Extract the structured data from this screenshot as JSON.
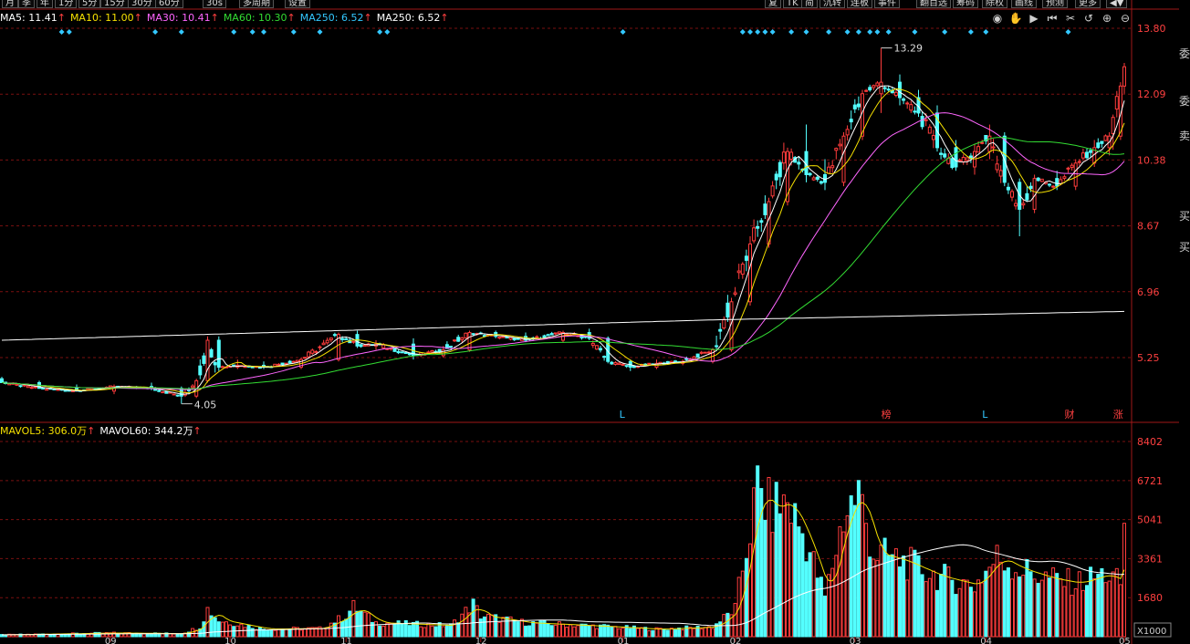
{
  "toolbar": {
    "left_buttons": [
      "月",
      "季",
      "年",
      "1分",
      "5分",
      "15分",
      "30分",
      "60分",
      "30s",
      "多周期",
      "设置"
    ],
    "right_buttons": [
      "复",
      "TK",
      "简",
      "沉转",
      "连板",
      "事件",
      "翻百选",
      "筹码",
      "除权",
      "画线",
      "预测",
      "更多"
    ]
  },
  "ma_legend": [
    {
      "label": "MA5: 11.41",
      "arrow": "↑",
      "color": "#ffffff"
    },
    {
      "label": "MA10: 11.00",
      "arrow": "↑",
      "color": "#f5e000"
    },
    {
      "label": "MA30: 10.41",
      "arrow": "↑",
      "color": "#ff66ff"
    },
    {
      "label": "MA60: 10.30",
      "arrow": "↑",
      "color": "#33dd33"
    },
    {
      "label": "MA250: 6.52",
      "arrow": "↑",
      "color": "#33c8ff"
    },
    {
      "label": "MA250: 6.52",
      "arrow": "↑",
      "color": "#ffffff"
    }
  ],
  "vol_legend": [
    {
      "label": "MAVOL5: 306.0万",
      "arrow": "↑",
      "color": "#f5e000"
    },
    {
      "label": "MAVOL60: 344.2万",
      "arrow": "↑",
      "color": "#ffffff"
    }
  ],
  "chart_tools": [
    "eye-icon",
    "hand-icon",
    "play-icon",
    "rewind-icon",
    "scissors-icon",
    "replay-icon",
    "zoom-in-icon",
    "zoom-out-icon"
  ],
  "colors": {
    "up": "#ff3c3c",
    "down": "#54ffff",
    "grid": "#7a1010",
    "axis_text": "#ff4040",
    "bg": "#000000"
  },
  "chart_data": {
    "type": "candlestick",
    "price_axis_ticks": [
      "13.80",
      "12.09",
      "10.38",
      "8.67",
      "6.96",
      "5.25"
    ],
    "price_range": [
      3.54,
      13.8
    ],
    "volume_axis_ticks": [
      "8402",
      "6721",
      "5041",
      "3361",
      "1680"
    ],
    "volume_range": [
      0,
      8402
    ],
    "volume_unit": "X1000",
    "x_tick_labels": [
      "09",
      "10",
      "11",
      "12",
      "01",
      "02",
      "03",
      "04",
      "05"
    ],
    "annotations": [
      {
        "text": "13.29",
        "kind": "high"
      },
      {
        "text": "4.05",
        "kind": "low"
      }
    ],
    "event_markers": [
      {
        "text": "L",
        "color": "#33c8ff"
      },
      {
        "text": "榜",
        "color": "#ff4040"
      },
      {
        "text": "L",
        "color": "#33c8ff"
      },
      {
        "text": "财",
        "color": "#ff4040"
      },
      {
        "text": "涨",
        "color": "#ff4040"
      }
    ],
    "ohlc_anchors": [
      [
        0,
        4.7,
        4.75,
        4.62,
        4.6
      ],
      [
        10,
        4.6,
        4.65,
        4.55,
        4.45
      ],
      [
        20,
        4.45,
        4.55,
        4.4,
        4.38
      ],
      [
        30,
        4.38,
        4.55,
        4.3,
        4.5
      ],
      [
        40,
        4.5,
        4.6,
        4.4,
        4.45
      ],
      [
        48,
        4.45,
        4.5,
        4.05,
        4.25
      ],
      [
        52,
        4.25,
        4.7,
        4.2,
        4.65
      ],
      [
        55,
        4.65,
        5.8,
        4.6,
        5.7
      ],
      [
        58,
        5.7,
        5.8,
        4.9,
        5.0
      ],
      [
        63,
        5.0,
        5.2,
        4.95,
        5.05
      ],
      [
        70,
        5.05,
        5.15,
        4.95,
        5.0
      ],
      [
        80,
        5.0,
        5.25,
        4.95,
        5.2
      ],
      [
        90,
        5.2,
        5.9,
        5.15,
        5.85
      ],
      [
        95,
        5.85,
        5.95,
        5.5,
        5.55
      ],
      [
        100,
        5.55,
        5.7,
        5.45,
        5.6
      ],
      [
        110,
        5.6,
        5.75,
        5.2,
        5.3
      ],
      [
        118,
        5.3,
        5.55,
        5.25,
        5.45
      ],
      [
        125,
        5.45,
        5.95,
        5.4,
        5.9
      ],
      [
        132,
        5.9,
        5.95,
        5.75,
        5.8
      ],
      [
        140,
        5.8,
        5.9,
        5.65,
        5.7
      ],
      [
        150,
        5.7,
        5.95,
        5.65,
        5.9
      ],
      [
        157,
        5.9,
        6.0,
        5.7,
        5.75
      ],
      [
        162,
        5.75,
        5.8,
        5.1,
        5.15
      ],
      [
        168,
        5.15,
        5.2,
        4.9,
        5.0
      ],
      [
        175,
        5.0,
        5.2,
        4.95,
        5.1
      ],
      [
        182,
        5.1,
        5.2,
        5.05,
        5.15
      ],
      [
        190,
        5.15,
        5.5,
        5.1,
        5.45
      ],
      [
        195,
        5.45,
        6.8,
        5.4,
        6.7
      ],
      [
        200,
        6.7,
        8.4,
        6.6,
        8.2
      ],
      [
        205,
        8.2,
        9.4,
        8.1,
        9.3
      ],
      [
        210,
        9.3,
        10.7,
        9.2,
        10.6
      ],
      [
        215,
        10.6,
        11.3,
        9.8,
        10.0
      ],
      [
        220,
        10.0,
        10.4,
        9.6,
        9.8
      ],
      [
        225,
        9.8,
        11.1,
        9.7,
        11.0
      ],
      [
        230,
        11.0,
        12.2,
        10.9,
        12.1
      ],
      [
        235,
        12.1,
        13.29,
        11.6,
        12.4
      ],
      [
        240,
        12.4,
        12.6,
        11.8,
        12.0
      ],
      [
        245,
        12.0,
        12.2,
        11.5,
        11.6
      ],
      [
        250,
        11.6,
        11.8,
        10.6,
        10.7
      ],
      [
        255,
        10.7,
        10.9,
        10.1,
        10.2
      ],
      [
        260,
        10.2,
        10.8,
        10.0,
        10.6
      ],
      [
        264,
        10.6,
        11.3,
        10.4,
        11.0
      ],
      [
        268,
        11.0,
        11.1,
        9.7,
        9.8
      ],
      [
        272,
        9.8,
        9.9,
        8.4,
        9.1
      ],
      [
        276,
        9.1,
        10.0,
        9.0,
        9.9
      ],
      [
        282,
        9.9,
        10.1,
        9.6,
        9.7
      ],
      [
        287,
        9.7,
        10.4,
        9.6,
        10.3
      ],
      [
        292,
        10.3,
        10.9,
        10.2,
        10.7
      ],
      [
        296,
        10.7,
        11.1,
        10.5,
        11.0
      ],
      [
        299,
        11.0,
        12.4,
        10.9,
        12.3
      ],
      [
        300,
        12.3,
        12.9,
        12.1,
        12.8
      ]
    ],
    "volume_anchors": [
      [
        0,
        80
      ],
      [
        30,
        160
      ],
      [
        48,
        130
      ],
      [
        53,
        420
      ],
      [
        55,
        1200
      ],
      [
        58,
        700
      ],
      [
        70,
        330
      ],
      [
        85,
        350
      ],
      [
        92,
        900
      ],
      [
        94,
        1300
      ],
      [
        100,
        600
      ],
      [
        120,
        480
      ],
      [
        126,
        1400
      ],
      [
        128,
        900
      ],
      [
        140,
        600
      ],
      [
        160,
        450
      ],
      [
        175,
        320
      ],
      [
        190,
        420
      ],
      [
        196,
        1200
      ],
      [
        199,
        3800
      ],
      [
        202,
        6400
      ],
      [
        205,
        5500
      ],
      [
        210,
        5800
      ],
      [
        215,
        4100
      ],
      [
        220,
        1700
      ],
      [
        225,
        5200
      ],
      [
        229,
        6200
      ],
      [
        233,
        3600
      ],
      [
        240,
        3300
      ],
      [
        250,
        2600
      ],
      [
        260,
        2200
      ],
      [
        266,
        3400
      ],
      [
        272,
        2900
      ],
      [
        280,
        2500
      ],
      [
        287,
        2300
      ],
      [
        295,
        2700
      ],
      [
        299,
        2300
      ],
      [
        300,
        4600
      ]
    ]
  }
}
